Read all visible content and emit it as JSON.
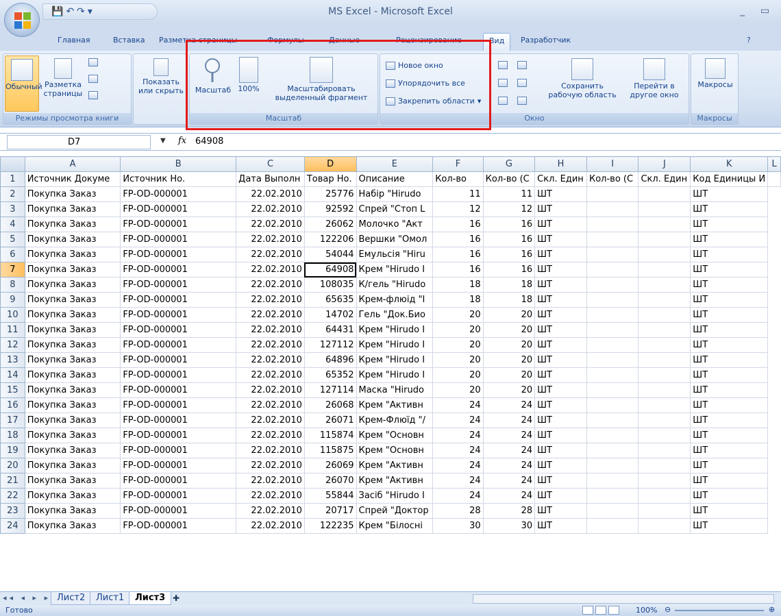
{
  "window": {
    "title": "MS Excel - Microsoft Excel",
    "minimize": "_",
    "restore": "▭"
  },
  "tabs": [
    "Главная",
    "Вставка",
    "Разметка страницы",
    "Формулы",
    "Данные",
    "Рецензирование",
    "Вид",
    "Разработчик"
  ],
  "active_tab": "Вид",
  "ribbon": {
    "views": {
      "normal": "Обычный",
      "page_layout": "Разметка страницы",
      "label": "Режимы просмотра книги"
    },
    "show": {
      "label": "Показать или скрыть"
    },
    "zoom": {
      "zoom_btn": "Масштаб",
      "hundred": "100%",
      "selection": "Масштабировать выделенный фрагмент",
      "label": "Масштаб"
    },
    "window": {
      "new_window": "Новое окно",
      "arrange_all": "Упорядочить все",
      "freeze": "Закрепить области",
      "save_ws": "Сохранить рабочую область",
      "switch": "Перейти в другое окно",
      "label": "Окно"
    },
    "macros": {
      "btn": "Макросы",
      "label": "Макросы"
    }
  },
  "formula_bar": {
    "name_box": "D7",
    "fx": "fx",
    "value": "64908"
  },
  "columns": [
    "A",
    "B",
    "C",
    "D",
    "E",
    "F",
    "G",
    "H",
    "I",
    "J",
    "K",
    "L"
  ],
  "header_row": [
    "Источник Докуме",
    "Источник Но.",
    "Дата Выполн",
    "Товар Но.",
    "Описание",
    "Кол-во",
    "Кол-во (С",
    "Скл. Един",
    "Кол-во (С",
    "Скл. Един",
    "Код Единицы И",
    ""
  ],
  "rows": [
    [
      "2",
      "Покупка Заказ",
      "FP-OD-000001",
      "22.02.2010",
      "25776",
      "Набір \"Hirudo",
      "11",
      "11",
      "ШТ",
      "",
      "",
      "ШТ"
    ],
    [
      "3",
      "Покупка Заказ",
      "FP-OD-000001",
      "22.02.2010",
      "92592",
      "Спрей \"Стоп L",
      "12",
      "12",
      "ШТ",
      "",
      "",
      "ШТ"
    ],
    [
      "4",
      "Покупка Заказ",
      "FP-OD-000001",
      "22.02.2010",
      "26062",
      "Молочко \"Акт",
      "16",
      "16",
      "ШТ",
      "",
      "",
      "ШТ"
    ],
    [
      "5",
      "Покупка Заказ",
      "FP-OD-000001",
      "22.02.2010",
      "122206",
      "Вершки \"Омол",
      "16",
      "16",
      "ШТ",
      "",
      "",
      "ШТ"
    ],
    [
      "6",
      "Покупка Заказ",
      "FP-OD-000001",
      "22.02.2010",
      "54044",
      "Емульсія \"Hiru",
      "16",
      "16",
      "ШТ",
      "",
      "",
      "ШТ"
    ],
    [
      "7",
      "Покупка Заказ",
      "FP-OD-000001",
      "22.02.2010",
      "64908",
      "Крем \"Hirudo I",
      "16",
      "16",
      "ШТ",
      "",
      "",
      "ШТ"
    ],
    [
      "8",
      "Покупка Заказ",
      "FP-OD-000001",
      "22.02.2010",
      "108035",
      "К/гель \"Hirudo",
      "18",
      "18",
      "ШТ",
      "",
      "",
      "ШТ"
    ],
    [
      "9",
      "Покупка Заказ",
      "FP-OD-000001",
      "22.02.2010",
      "65635",
      "Крем-флюід \"I",
      "18",
      "18",
      "ШТ",
      "",
      "",
      "ШТ"
    ],
    [
      "10",
      "Покупка Заказ",
      "FP-OD-000001",
      "22.02.2010",
      "14702",
      "Гель \"Док.Био",
      "20",
      "20",
      "ШТ",
      "",
      "",
      "ШТ"
    ],
    [
      "11",
      "Покупка Заказ",
      "FP-OD-000001",
      "22.02.2010",
      "64431",
      "Крем \"Hirudo I",
      "20",
      "20",
      "ШТ",
      "",
      "",
      "ШТ"
    ],
    [
      "12",
      "Покупка Заказ",
      "FP-OD-000001",
      "22.02.2010",
      "127112",
      "Крем \"Hirudo I",
      "20",
      "20",
      "ШТ",
      "",
      "",
      "ШТ"
    ],
    [
      "13",
      "Покупка Заказ",
      "FP-OD-000001",
      "22.02.2010",
      "64896",
      "Крем \"Hirudo I",
      "20",
      "20",
      "ШТ",
      "",
      "",
      "ШТ"
    ],
    [
      "14",
      "Покупка Заказ",
      "FP-OD-000001",
      "22.02.2010",
      "65352",
      "Крем \"Hirudo I",
      "20",
      "20",
      "ШТ",
      "",
      "",
      "ШТ"
    ],
    [
      "15",
      "Покупка Заказ",
      "FP-OD-000001",
      "22.02.2010",
      "127114",
      "Маска \"Hirudo",
      "20",
      "20",
      "ШТ",
      "",
      "",
      "ШТ"
    ],
    [
      "16",
      "Покупка Заказ",
      "FP-OD-000001",
      "22.02.2010",
      "26068",
      "Крем \"Активн",
      "24",
      "24",
      "ШТ",
      "",
      "",
      "ШТ"
    ],
    [
      "17",
      "Покупка Заказ",
      "FP-OD-000001",
      "22.02.2010",
      "26071",
      "Крем-Флюїд \"/",
      "24",
      "24",
      "ШТ",
      "",
      "",
      "ШТ"
    ],
    [
      "18",
      "Покупка Заказ",
      "FP-OD-000001",
      "22.02.2010",
      "115874",
      "Крем \"Основн",
      "24",
      "24",
      "ШТ",
      "",
      "",
      "ШТ"
    ],
    [
      "19",
      "Покупка Заказ",
      "FP-OD-000001",
      "22.02.2010",
      "115875",
      "Крем \"Основн",
      "24",
      "24",
      "ШТ",
      "",
      "",
      "ШТ"
    ],
    [
      "20",
      "Покупка Заказ",
      "FP-OD-000001",
      "22.02.2010",
      "26069",
      "Крем \"Активн",
      "24",
      "24",
      "ШТ",
      "",
      "",
      "ШТ"
    ],
    [
      "21",
      "Покупка Заказ",
      "FP-OD-000001",
      "22.02.2010",
      "26070",
      "Крем \"Активн",
      "24",
      "24",
      "ШТ",
      "",
      "",
      "ШТ"
    ],
    [
      "22",
      "Покупка Заказ",
      "FP-OD-000001",
      "22.02.2010",
      "55844",
      "Засіб \"Hirudo I",
      "24",
      "24",
      "ШТ",
      "",
      "",
      "ШТ"
    ],
    [
      "23",
      "Покупка Заказ",
      "FP-OD-000001",
      "22.02.2010",
      "20717",
      "Спрей \"Доктор",
      "28",
      "28",
      "ШТ",
      "",
      "",
      "ШТ"
    ],
    [
      "24",
      "Покупка Заказ",
      "FP-OD-000001",
      "22.02.2010",
      "122235",
      "Крем \"Білосні",
      "30",
      "30",
      "ШТ",
      "",
      "",
      "ШТ"
    ]
  ],
  "sheets": [
    "Лист2",
    "Лист1",
    "Лист3"
  ],
  "active_sheet": "Лист3",
  "status": {
    "ready": "Готово",
    "zoom": "100%"
  },
  "colors": {
    "highlight": "#e21a1a",
    "selected_header": "#ffbf5c"
  }
}
